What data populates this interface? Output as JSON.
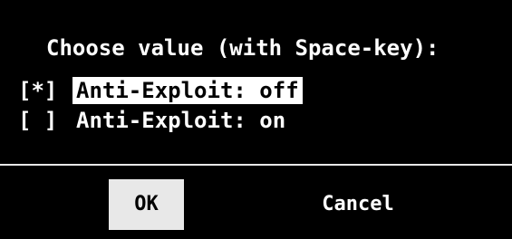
{
  "dialog": {
    "prompt": "Choose value (with Space-key):",
    "options": [
      {
        "marker": "[*]",
        "label": "Anti-Exploit: off",
        "selected": true
      },
      {
        "marker": "[ ]",
        "label": "Anti-Exploit: on",
        "selected": false
      }
    ],
    "buttons": {
      "ok": "OK",
      "cancel": "Cancel"
    }
  }
}
